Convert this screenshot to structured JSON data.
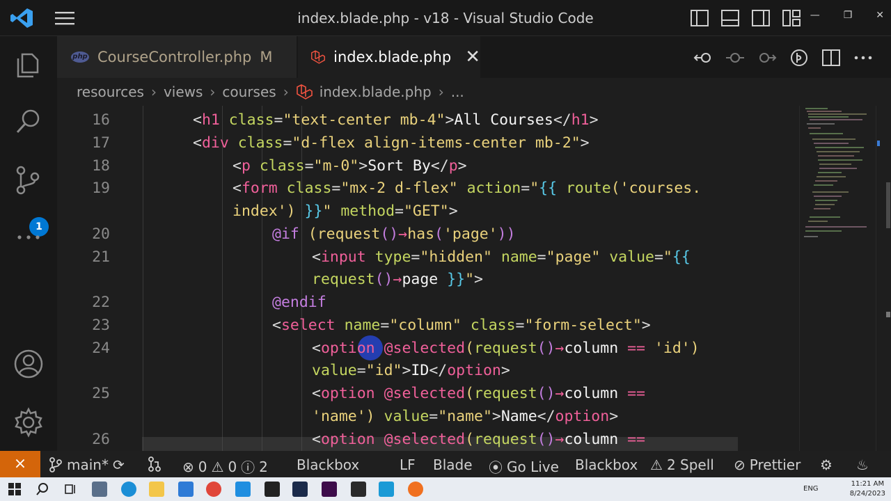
{
  "window": {
    "title": "index.blade.php - v18 - Visual Studio Code"
  },
  "activity_bar": {
    "source_control_badge": "1"
  },
  "tabs": [
    {
      "label": "CourseController.php",
      "status": "M",
      "icon": "php-icon"
    },
    {
      "label": "index.blade.php",
      "icon": "laravel-icon"
    }
  ],
  "breadcrumb": {
    "parts": [
      "resources",
      "views",
      "courses",
      "index.blade.php",
      "..."
    ]
  },
  "code": {
    "line_numbers": [
      "16",
      "17",
      "18",
      "19",
      "",
      "20",
      "21",
      "",
      "22",
      "23",
      "24",
      "",
      "25",
      "",
      "26"
    ],
    "lines": [
      [
        [
          "p",
          "<"
        ],
        [
          "t",
          "h1"
        ],
        [
          "a",
          " class"
        ],
        [
          "p",
          "="
        ],
        [
          "s",
          "\"text-center mb-4\""
        ],
        [
          "p",
          ">"
        ],
        [
          "w",
          "All Courses"
        ],
        [
          "p",
          "</"
        ],
        [
          "t",
          "h1"
        ],
        [
          "p",
          ">"
        ]
      ],
      [
        [
          "p",
          "<"
        ],
        [
          "t",
          "div"
        ],
        [
          "a",
          " class"
        ],
        [
          "p",
          "="
        ],
        [
          "s",
          "\"d-flex align-items-center mb-2\""
        ],
        [
          "p",
          ">"
        ]
      ],
      [
        [
          "p",
          "<"
        ],
        [
          "t",
          "p"
        ],
        [
          "a",
          " class"
        ],
        [
          "p",
          "="
        ],
        [
          "s",
          "\"m-0\""
        ],
        [
          "p",
          ">"
        ],
        [
          "w",
          "Sort By"
        ],
        [
          "p",
          "</"
        ],
        [
          "t",
          "p"
        ],
        [
          "p",
          ">"
        ]
      ],
      [
        [
          "p",
          "<"
        ],
        [
          "t",
          "form"
        ],
        [
          "a",
          " class"
        ],
        [
          "p",
          "="
        ],
        [
          "s",
          "\"mx-2 d-flex\""
        ],
        [
          "a",
          " action"
        ],
        [
          "p",
          "="
        ],
        [
          "s",
          "\""
        ],
        [
          "b",
          "{{"
        ],
        [
          "a",
          " route"
        ],
        [
          "s",
          "('courses."
        ]
      ],
      [
        [
          "s",
          "index')"
        ],
        [
          "b",
          " }}"
        ],
        [
          "s",
          "\""
        ],
        [
          "a",
          " method"
        ],
        [
          "p",
          "="
        ],
        [
          "s",
          "\"GET\""
        ],
        [
          "p",
          ">"
        ]
      ],
      [
        [
          "d",
          "@if"
        ],
        [
          "s",
          " (request"
        ],
        [
          "d",
          "()"
        ],
        [
          "t",
          "→"
        ],
        [
          "s",
          "has"
        ],
        [
          "d",
          "("
        ],
        [
          "s",
          "'page'"
        ],
        [
          "d",
          "))"
        ]
      ],
      [
        [
          "p",
          "<"
        ],
        [
          "t",
          "input"
        ],
        [
          "a",
          " type"
        ],
        [
          "p",
          "="
        ],
        [
          "s",
          "\"hidden\""
        ],
        [
          "a",
          " name"
        ],
        [
          "p",
          "="
        ],
        [
          "s",
          "\"page\""
        ],
        [
          "a",
          " value"
        ],
        [
          "p",
          "="
        ],
        [
          "s",
          "\""
        ],
        [
          "b",
          "{{"
        ]
      ],
      [
        [
          "a",
          "request"
        ],
        [
          "d",
          "()"
        ],
        [
          "t",
          "→"
        ],
        [
          "w",
          "page"
        ],
        [
          "b",
          " }}"
        ],
        [
          "s",
          "\""
        ],
        [
          "p",
          ">"
        ]
      ],
      [
        [
          "d",
          "@endif"
        ]
      ],
      [
        [
          "p",
          "<"
        ],
        [
          "t",
          "select"
        ],
        [
          "a",
          " name"
        ],
        [
          "p",
          "="
        ],
        [
          "s",
          "\"column\""
        ],
        [
          "a",
          " class"
        ],
        [
          "p",
          "="
        ],
        [
          "s",
          "\"form-select\""
        ],
        [
          "p",
          ">"
        ]
      ],
      [
        [
          "p",
          "<"
        ],
        [
          "t",
          "option"
        ],
        [
          "k",
          " @selected"
        ],
        [
          "s",
          "("
        ],
        [
          "a",
          "request"
        ],
        [
          "d",
          "()"
        ],
        [
          "t",
          "→"
        ],
        [
          "w",
          "column"
        ],
        [
          "k",
          " =="
        ],
        [
          "s",
          " 'id')"
        ]
      ],
      [
        [
          "a",
          "value"
        ],
        [
          "p",
          "="
        ],
        [
          "s",
          "\"id\""
        ],
        [
          "p",
          ">"
        ],
        [
          "w",
          "ID"
        ],
        [
          "p",
          "</"
        ],
        [
          "t",
          "option"
        ],
        [
          "p",
          ">"
        ]
      ],
      [
        [
          "p",
          "<"
        ],
        [
          "t",
          "option"
        ],
        [
          "k",
          " @selected"
        ],
        [
          "s",
          "("
        ],
        [
          "a",
          "request"
        ],
        [
          "d",
          "()"
        ],
        [
          "t",
          "→"
        ],
        [
          "w",
          "column"
        ],
        [
          "k",
          " =="
        ]
      ],
      [
        [
          "s",
          "'name')"
        ],
        [
          "a",
          " value"
        ],
        [
          "p",
          "="
        ],
        [
          "s",
          "\"name\""
        ],
        [
          "p",
          ">"
        ],
        [
          "w",
          "Name"
        ],
        [
          "p",
          "</"
        ],
        [
          "t",
          "option"
        ],
        [
          "p",
          ">"
        ]
      ],
      [
        [
          "p",
          "<"
        ],
        [
          "t",
          "option"
        ],
        [
          "k",
          " @selected"
        ],
        [
          "s",
          "("
        ],
        [
          "a",
          "request"
        ],
        [
          "d",
          "()"
        ],
        [
          "t",
          "→"
        ],
        [
          "w",
          "column"
        ],
        [
          "k",
          " =="
        ]
      ]
    ]
  },
  "status_bar": {
    "branch": "main*",
    "errors": "0",
    "warnings": "0",
    "infos": "2",
    "blackbox_left": "Blackbox",
    "eol": "LF",
    "language": "Blade",
    "go_live": "Go Live",
    "blackbox_right": "Blackbox",
    "spell": "2 Spell",
    "prettier": "Prettier"
  },
  "taskbar": {
    "lang": "ENG",
    "time": "11:21 AM",
    "date": "8/24/2023"
  },
  "colors": {
    "accent": "#0078d4",
    "remote": "#d4650a"
  }
}
